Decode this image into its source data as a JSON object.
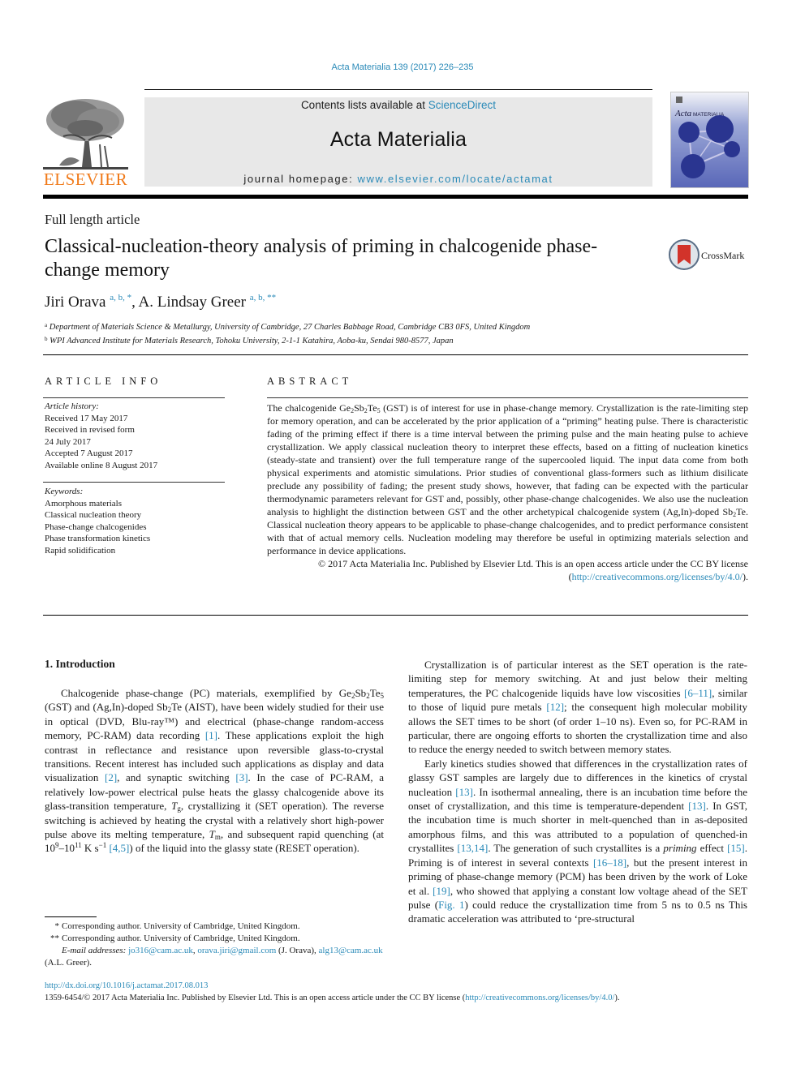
{
  "header": {
    "citation": "Acta Materialia 139 (2017) 226–235",
    "publisher_logo_text": "ELSEVIER",
    "contents_prefix": "Contents lists available at ",
    "contents_link": "ScienceDirect",
    "journal_title": "Acta Materialia",
    "homepage_prefix": "journal homepage: ",
    "homepage_link": "www.elsevier.com/locate/actamat",
    "cover_title": "Acta MATERIALIA"
  },
  "article": {
    "type": "Full length article",
    "title": "Classical-nucleation-theory analysis of priming in chalcogenide phase-change memory",
    "crossmark_label": "CrossMark",
    "authors": [
      {
        "name": "Jiri Orava",
        "marks": "a, b, *"
      },
      {
        "name": "A. Lindsay Greer",
        "marks": "a, b, **"
      }
    ],
    "author_separator": ", ",
    "affiliations": [
      {
        "mark": "a",
        "text": "Department of Materials Science & Metallurgy, University of Cambridge, 27 Charles Babbage Road, Cambridge CB3 0FS, United Kingdom"
      },
      {
        "mark": "b",
        "text": "WPI Advanced Institute for Materials Research, Tohoku University, 2-1-1 Katahira, Aoba-ku, Sendai 980-8577, Japan"
      }
    ]
  },
  "article_info": {
    "heading": "ARTICLE INFO",
    "history_label": "Article history:",
    "history": [
      "Received 17 May 2017",
      "Received in revised form",
      "24 July 2017",
      "Accepted 7 August 2017",
      "Available online 8 August 2017"
    ],
    "keywords_label": "Keywords:",
    "keywords": [
      "Amorphous materials",
      "Classical nucleation theory",
      "Phase-change chalcogenides",
      "Phase transformation kinetics",
      "Rapid solidification"
    ]
  },
  "abstract": {
    "heading": "ABSTRACT",
    "p1_a": "The chalcogenide Ge",
    "p1_b": "Sb",
    "p1_c": "Te",
    "p1_d": " (GST) is of interest for use in phase-change memory. Crystallization is the rate-limiting step for memory operation, and can be accelerated by the prior application of a “priming” heating pulse. There is characteristic fading of the priming effect if there is a time interval between the priming pulse and the main heating pulse to achieve crystallization. We apply classical nucleation theory to interpret these effects, based on a fitting of nucleation kinetics (steady-state and transient) over the full temperature range of the supercooled liquid. The input data come from both physical experiments and atomistic simulations. Prior studies of conventional glass-formers such as lithium disilicate preclude any possibility of fading; the present study shows, however, that fading can be expected with the particular thermodynamic parameters relevant for GST and, possibly, other phase-change chalcogenides. We also use the nucleation analysis to highlight the distinction between GST and the other archetypical chalcogenide system (Ag,In)-doped Sb",
    "p1_e": "Te. Classical nucleation theory appears to be applicable to phase-change chalcogenides, and to predict performance consistent with that of actual memory cells. Nucleation modeling may therefore be useful in optimizing materials selection and performance in device applications.",
    "sub2": "2",
    "sub5": "5",
    "copyright": "© 2017 Acta Materialia Inc. Published by Elsevier Ltd. This is an open access article under the CC BY license (",
    "license_link": "http://creativecommons.org/licenses/by/4.0/",
    "copyright_end": ")."
  },
  "body": {
    "section_heading": "1.  Introduction",
    "left_p1": [
      "Chalcogenide phase-change (PC) materials, exemplified by Ge",
      "2",
      "Sb",
      "2",
      "Te",
      "5",
      " (GST) and (Ag,In)-doped Sb",
      "2",
      "Te (AIST), have been widely studied for their use in optical (DVD, Blu-ray™) and electrical (phase-change random-access memory, PC-RAM) data recording ",
      "[1]",
      ". These applications exploit the high contrast in reflectance and resistance upon reversible glass-to-crystal transitions. Recent interest has included such applications as display and data visualization ",
      "[2]",
      ", and synaptic switching ",
      "[3]",
      ". In the case of PC-RAM, a relatively low-power electrical pulse heats the glassy chalcogenide above its glass-transition temperature, ",
      "T",
      "g",
      ", crystallizing it (SET operation). The reverse switching is achieved by heating the crystal with a relatively short high-power pulse above its melting temperature, ",
      "T",
      "m",
      ", and subsequent rapid quenching (at 10",
      "9",
      "–10",
      "11",
      " K s",
      "−1",
      " ",
      "[4,5]",
      ") of the liquid into the glassy state (RESET operation)."
    ],
    "right_p1": [
      "Crystallization is of particular interest as the SET operation is the rate-limiting step for memory switching. At and just below their melting temperatures, the PC chalcogenide liquids have low viscosities ",
      "[6–11]",
      ", similar to those of liquid pure metals ",
      "[12]",
      "; the consequent high molecular mobility allows the SET times to be short (of order 1–10 ns). Even so, for PC-RAM in particular, there are ongoing efforts to shorten the crystallization time and also to reduce the energy needed to switch between memory states."
    ],
    "right_p2": [
      "Early kinetics studies showed that differences in the crystallization rates of glassy GST samples are largely due to differences in the kinetics of crystal nucleation ",
      "[13]",
      ". In isothermal annealing, there is an incubation time before the onset of crystallization, and this time is temperature-dependent ",
      "[13]",
      ". In GST, the incubation time is much shorter in melt-quenched than in as-deposited amorphous films, and this was attributed to a population of quenched-in crystallites ",
      "[13,14]",
      ". The generation of such crystallites is a ",
      "priming",
      " effect ",
      "[15]",
      ". Priming is of interest in several contexts ",
      "[16–18]",
      ", but the present interest in priming of phase-change memory (PCM) has been driven by the work of Loke et al. ",
      "[19]",
      ", who showed that applying a constant low voltage ahead of the SET pulse (",
      "Fig. 1",
      ") could reduce the crystallization time from 5 ns to 0.5 ns This dramatic acceleration was attributed to ‘pre-structural"
    ]
  },
  "footnotes": {
    "fn1_mark": "*",
    "fn1_text": "Corresponding author. University of Cambridge, United Kingdom.",
    "fn2_mark": "**",
    "fn2_text": "Corresponding author. University of Cambridge, United Kingdom.",
    "email_label": "E-mail addresses:",
    "email1": "jo316@cam.ac.uk",
    "email2": "orava.jiri@gmail.com",
    "email2_owner": " (J. Orava), ",
    "email3": "alg13@cam.ac.uk",
    "email3_owner": " (A.L. Greer)."
  },
  "footer": {
    "doi": "http://dx.doi.org/10.1016/j.actamat.2017.08.013",
    "issn_text": "1359-6454/© 2017 Acta Materialia Inc. Published by Elsevier Ltd. This is an open access article under the CC BY license (",
    "license_link": "http://creativecommons.org/licenses/by/4.0/",
    "issn_end": ")."
  },
  "colors": {
    "link": "#2a8ab8",
    "elsevier_orange": "#f07a1a",
    "journal_box_bg": "#e8e8e8"
  }
}
